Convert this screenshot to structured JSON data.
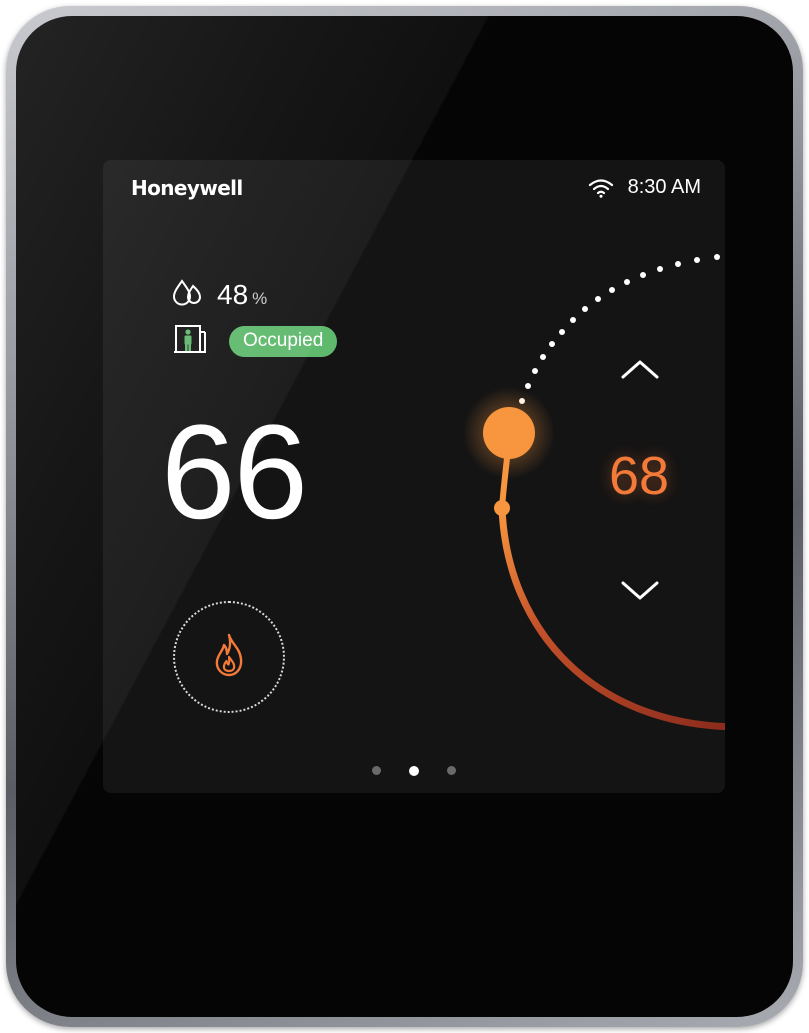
{
  "device": {
    "brand": "Honeywell",
    "time": "8:30 AM",
    "wifi_icon": "wifi-icon"
  },
  "humidity": {
    "icon": "water-drops-icon",
    "value": "48",
    "unit": "%"
  },
  "occupancy": {
    "icon": "occupied-door-person-icon",
    "status": "Occupied",
    "badge_color": "#5fb96d"
  },
  "current_temperature": "66",
  "setpoint": {
    "value": "68",
    "color": "#f47a3a",
    "up_icon": "chevron-up-icon",
    "down_icon": "chevron-down-icon"
  },
  "mode": {
    "icon": "flame-icon",
    "color": "#f47a3a"
  },
  "pagination": {
    "total": 3,
    "active_index": 1
  },
  "colors": {
    "accent_orange": "#f7963f",
    "heat_arc_end": "#8a2a1c",
    "screen_bg": "#141414"
  }
}
